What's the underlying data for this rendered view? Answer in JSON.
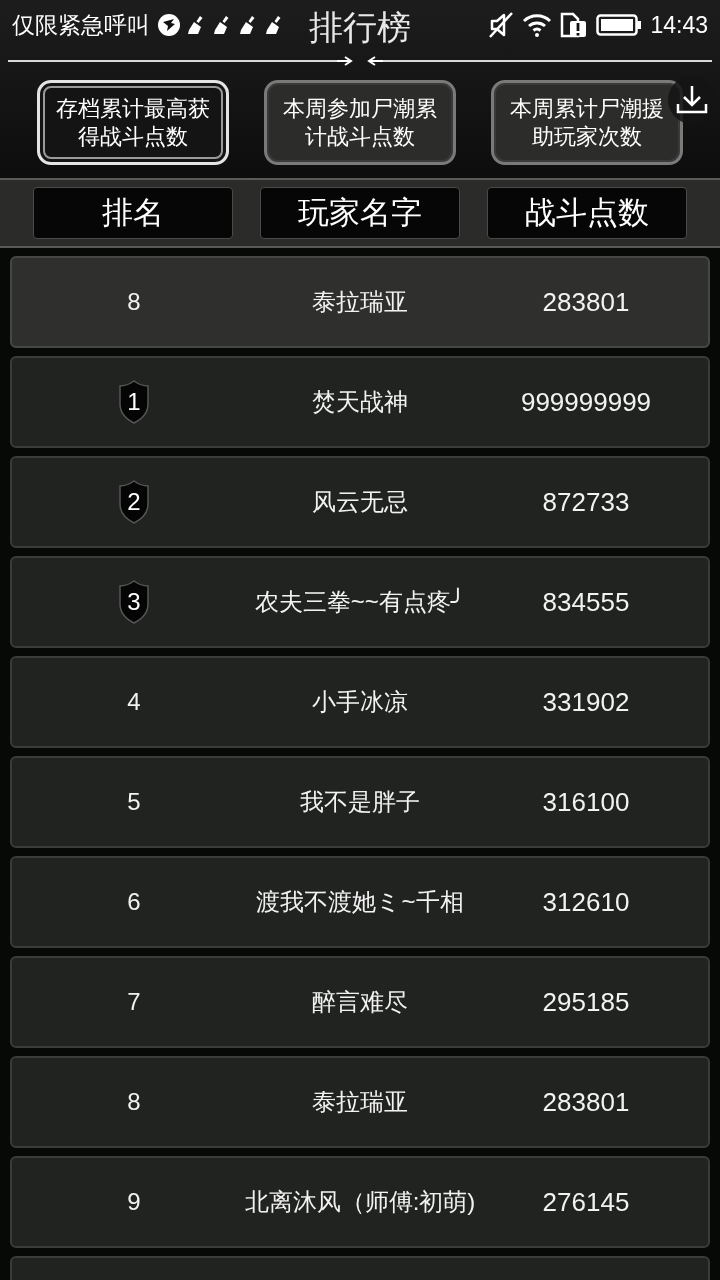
{
  "status_bar": {
    "notice": "仅限紧急呼叫",
    "time": "14:43"
  },
  "title": "排行榜",
  "tabs": [
    {
      "label": "存档累计最高获得战斗点数",
      "selected": true
    },
    {
      "label": "本周参加尸潮累计战斗点数",
      "selected": false
    },
    {
      "label": "本周累计尸潮援助玩家次数",
      "selected": false
    }
  ],
  "columns": [
    "排名",
    "玩家名字",
    "战斗点数"
  ],
  "my_entry": {
    "kind": "plain",
    "rank": "8",
    "name": "泰拉瑞亚",
    "score": "283801"
  },
  "rows": [
    {
      "kind": "medal",
      "rank": "1",
      "name": "焚天战神",
      "score": "999999999"
    },
    {
      "kind": "medal",
      "rank": "2",
      "name": "风云无忌",
      "score": "872733"
    },
    {
      "kind": "medal",
      "rank": "3",
      "name": "农夫三拳~~有点疼╯",
      "score": "834555"
    },
    {
      "kind": "plain",
      "rank": "4",
      "name": "小手冰凉",
      "score": "331902"
    },
    {
      "kind": "plain",
      "rank": "5",
      "name": "我不是胖子",
      "score": "316100"
    },
    {
      "kind": "plain",
      "rank": "6",
      "name": "渡我不渡她ミ~千相",
      "score": "312610"
    },
    {
      "kind": "plain",
      "rank": "7",
      "name": "醉言难尽",
      "score": "295185"
    },
    {
      "kind": "plain",
      "rank": "8",
      "name": "泰拉瑞亚",
      "score": "283801"
    },
    {
      "kind": "plain",
      "rank": "9",
      "name": "北离沐风（师傅:初萌)",
      "score": "276145"
    }
  ]
}
